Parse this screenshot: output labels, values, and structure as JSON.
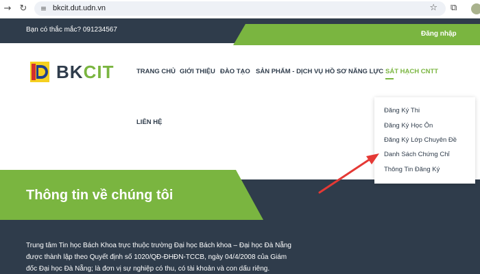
{
  "browser": {
    "url": "bkcit.dut.udn.vn"
  },
  "topbar": {
    "hotline": "Bạn có thắc mắc? 091234567",
    "login_label": "Đăng nhập"
  },
  "brand": {
    "part1": "BK",
    "part2": "CIT"
  },
  "menu": {
    "items": [
      "TRANG CHỦ",
      "GIỚI THIỆU",
      "ĐÀO TẠO",
      "SẢN PHẨM - DỊCH VỤ",
      "HỒ SƠ NĂNG LỰC",
      "SÁT HẠCH CNTT",
      "LIÊN HỆ"
    ],
    "active": "SÁT HẠCH CNTT"
  },
  "dropdown": {
    "items": [
      "Đăng Ký Thi",
      "Đăng Ký Học Ôn",
      "Đăng Ký Lớp Chuyên Đề",
      "Danh Sách Chứng Chỉ",
      "Thông Tin Đăng Ký"
    ],
    "highlighted": "Danh Sách Chứng Chỉ"
  },
  "hero": {
    "title": "Thông tin về chúng tôi",
    "body_lines": [
      "Trung tâm Tin học Bách Khoa trực thuộc trường Đại học Bách khoa – Đại học Đà Nẵng",
      "được thành lập theo Quyết định số 1020/QĐ-ĐHĐN-TCCB, ngày 04/4/2008 của Giám",
      "đốc Đại học Đà Nẵng; là đơn vị sự nghiệp có thu, có tài khoản và con dấu riêng."
    ]
  },
  "colors": {
    "navy": "#2f3c4b",
    "green": "#7ab540",
    "annotation_arrow": "#e53935"
  }
}
